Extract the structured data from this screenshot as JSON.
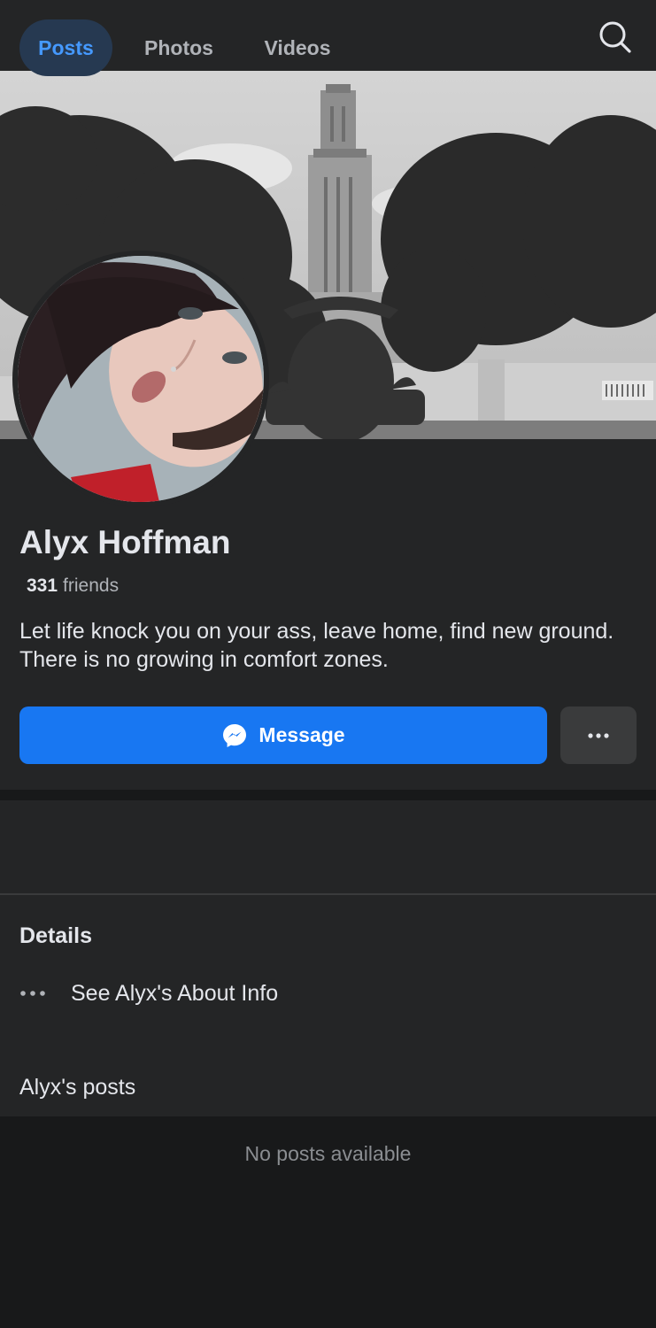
{
  "header": {
    "back_icon": "chevron-left-icon",
    "search_icon": "search-icon"
  },
  "profile": {
    "name": "Alyx Hoffman",
    "friends_count": "331",
    "friends_label": "friends",
    "bio": "Let life knock you on your ass, leave home, find new ground. There is no growing in comfort zones."
  },
  "actions": {
    "message_label": "Message",
    "message_icon": "messenger-icon",
    "more_icon": "more-horizontal-icon"
  },
  "tabs": [
    {
      "label": "Posts",
      "active": true
    },
    {
      "label": "Photos",
      "active": false
    },
    {
      "label": "Videos",
      "active": false
    }
  ],
  "details": {
    "title": "Details",
    "about_label": "See Alyx's About Info"
  },
  "posts": {
    "title": "Alyx's posts",
    "empty_text": "No posts available"
  },
  "colors": {
    "background": "#18191a",
    "surface": "#242526",
    "accent": "#1877f2",
    "active_tab_text": "#4599ff"
  }
}
